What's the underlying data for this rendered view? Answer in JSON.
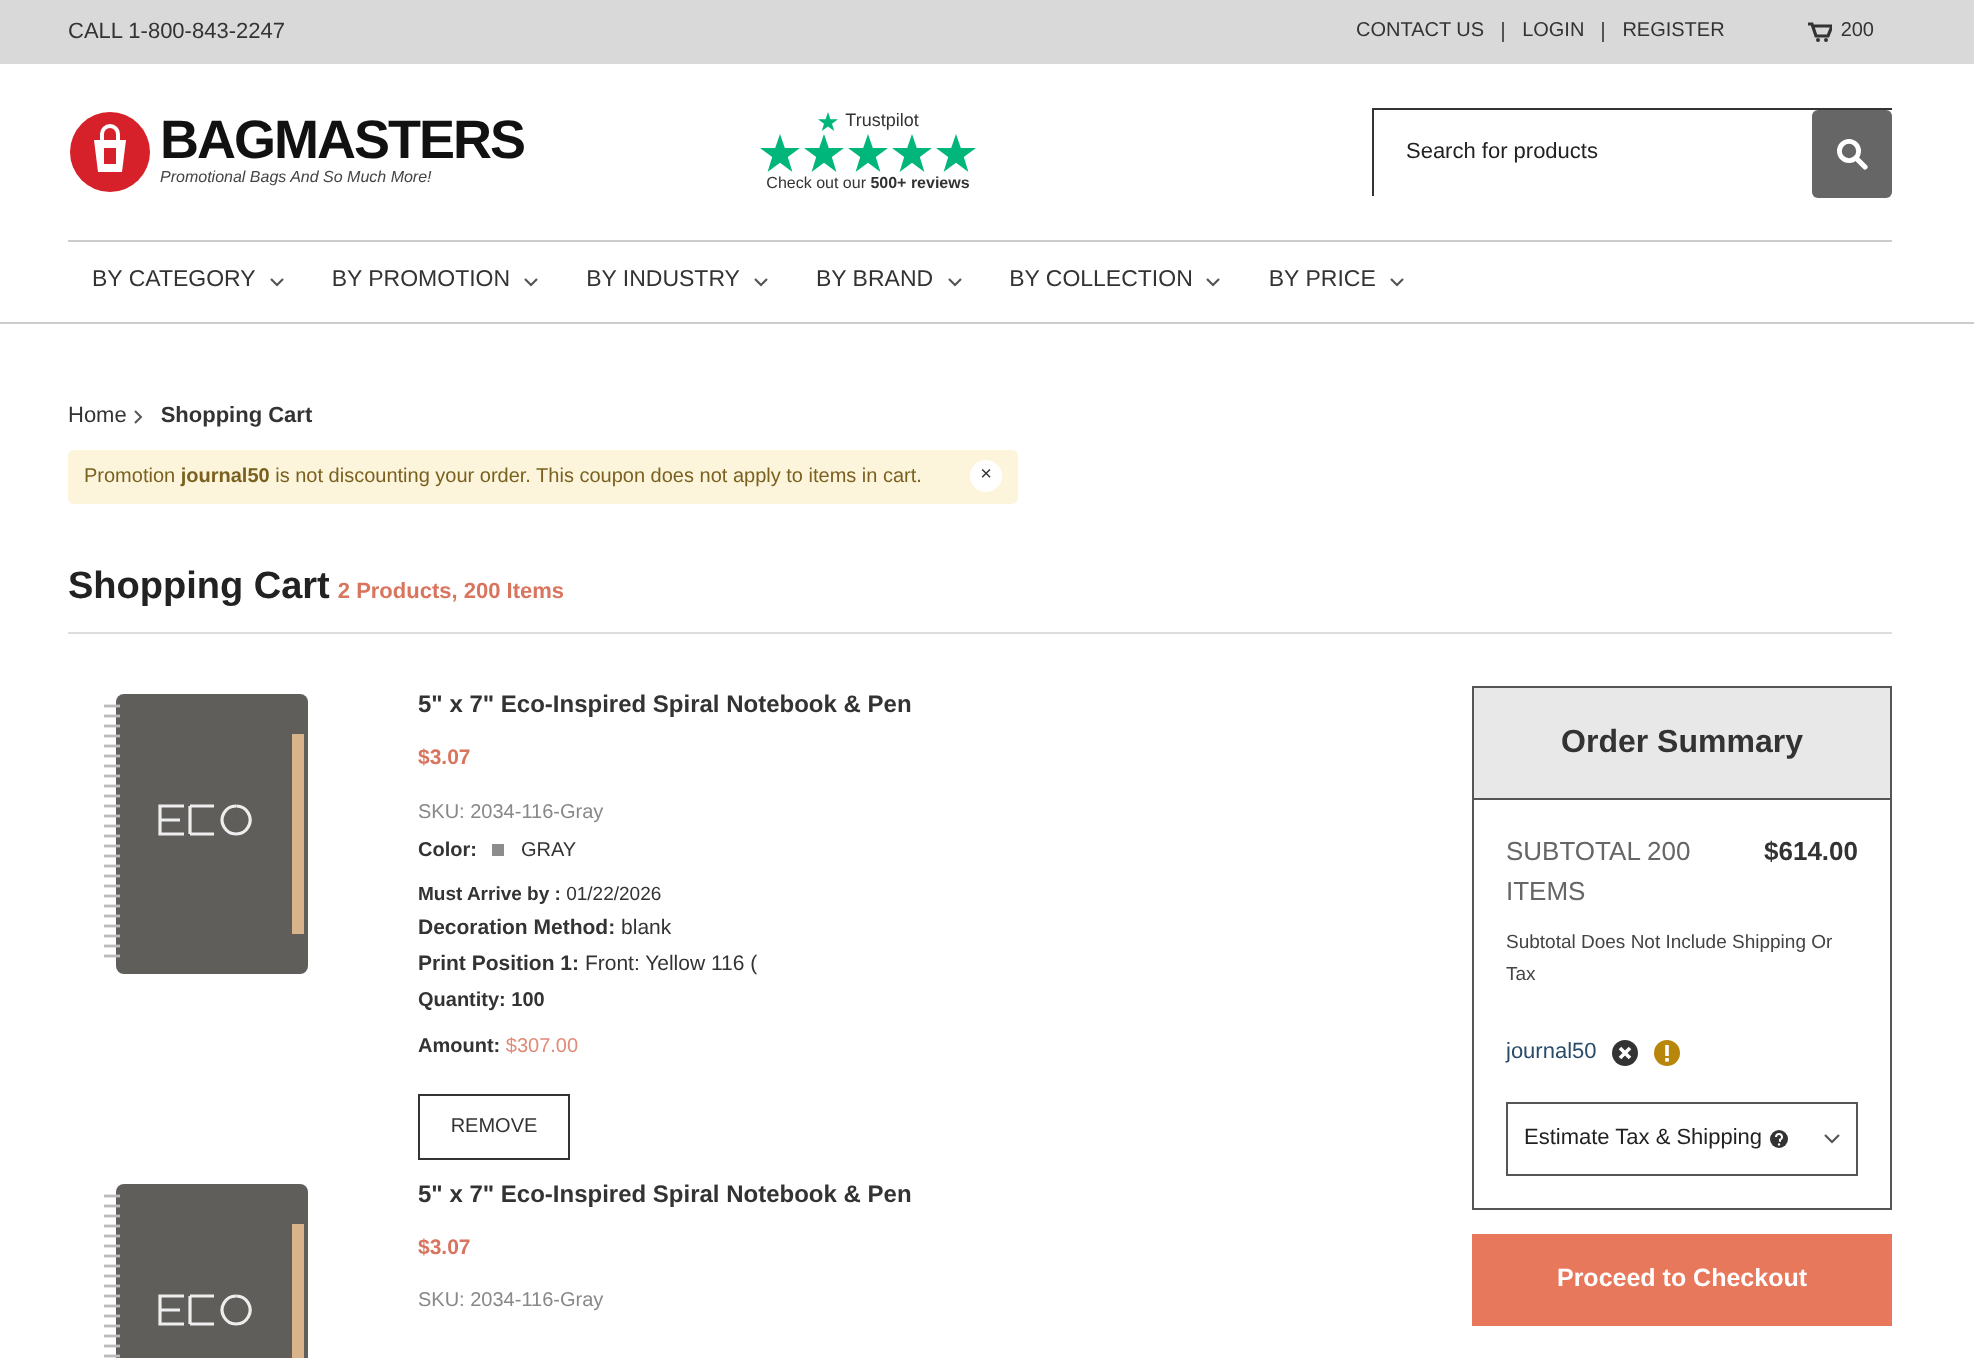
{
  "top_bar": {
    "phone": "CALL 1-800-843-2247",
    "links": [
      "CONTACT US",
      "LOGIN",
      "REGISTER"
    ],
    "cart_count": "200"
  },
  "header": {
    "logo_name": "BAGMASTERS",
    "logo_tagline": "Promotional Bags And So Much More!",
    "trustpilot": {
      "label": "Trustpilot",
      "stars": 5,
      "caption": "Check out our **500+ reviews**"
    },
    "search": {
      "placeholder": "Search for products"
    }
  },
  "nav": [
    "BY CATEGORY",
    "BY PROMOTION",
    "BY INDUSTRY",
    "BY BRAND",
    "BY COLLECTION",
    "BY PRICE"
  ],
  "breadcrumb": [
    "Home",
    "Shopping Cart"
  ],
  "alert": {
    "text": "Promotion **journal50** is not discounting your order. This coupon does not apply to items in cart.",
    "close": "×"
  },
  "cart": {
    "title": "Shopping Cart",
    "count": "2 Products, 200 Items",
    "items": [
      {
        "name": "5\" x 7\" Eco-Inspired Spiral Notebook & Pen",
        "price": "$3.07",
        "sku": "SKU: 2034-116-Gray",
        "color_label": "Color:",
        "color_name": "GRAY",
        "color": "#8c8c8c",
        "details": [
          {
            "label": "Must Arrive by :",
            "value": "01/22/2026",
            "kind": "small"
          },
          {
            "label": "Decoration Method:",
            "value": "blank",
            "kind": "normal"
          },
          {
            "label": "Print Position 1:",
            "value": "Front: Yellow 116 (",
            "kind": "normal"
          },
          {
            "label": "Quantity:",
            "value": "100",
            "kind": "bold"
          }
        ],
        "amount_label": "Amount:",
        "amount": "$307.00",
        "remove": "REMOVE"
      },
      {
        "name": "5\" x 7\" Eco-Inspired Spiral Notebook & Pen",
        "price": "$3.07",
        "sku": "SKU: 2034-116-Gray"
      }
    ]
  },
  "summary": {
    "title": "Order Summary",
    "subtotal_label": "SUBTOTAL 200 ITEMS",
    "subtotal": "$614.00",
    "note": "Subtotal Does Not Include Shipping Or Tax",
    "coupon": "journal50",
    "estimate": "Estimate Tax & Shipping",
    "checkout": "Proceed to Checkout"
  }
}
